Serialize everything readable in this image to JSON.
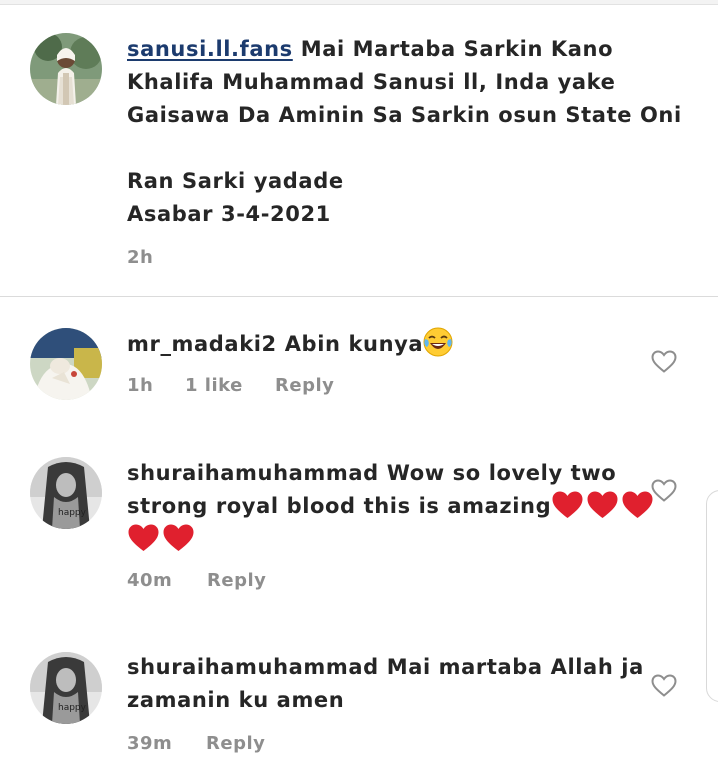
{
  "caption": {
    "username": "sanusi.ll.fans",
    "lines": [
      "Mai Martaba Sarkin Kano",
      "Khalifa Muhammad Sanusi ll, Inda yake",
      "Gaisawa Da Aminin Sa Sarkin osun State Oni",
      "Ran Sarki yadade",
      "Asabar 3-4-2021"
    ],
    "time": "2h"
  },
  "comments": [
    {
      "username": "mr_madaki2",
      "text": "Abin kunya",
      "time": "1h",
      "likes": "1 like",
      "reply": "Reply"
    },
    {
      "username": "shuraihamuhammad",
      "text_line1": "Wow so lovely two",
      "text_line2": "strong royal blood this is amazing",
      "time": "40m",
      "reply": "Reply",
      "avatar_label": "happy"
    },
    {
      "username": "shuraihamuhammad",
      "text_line1": "Mai martaba Allah ja",
      "text_line2": "zamanin ku amen",
      "time": "39m",
      "reply": "Reply",
      "avatar_label": "happy"
    }
  ],
  "icons": {
    "heart_outline": "heart-outline-icon",
    "laugh_emoji": "face-with-tears-of-joy-icon",
    "red_heart_emoji": "red-heart-icon"
  },
  "colors": {
    "text": "#262626",
    "meta": "#8e8e8e",
    "link_username": "#1c3b6e",
    "emoji_heart": "#e0202e"
  }
}
